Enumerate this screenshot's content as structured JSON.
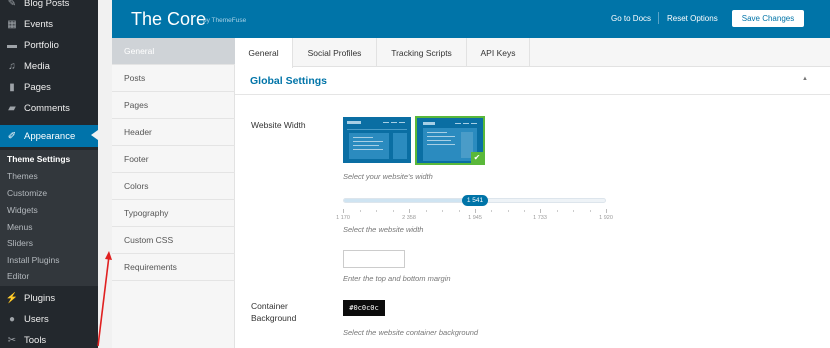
{
  "wp_menu": {
    "items": [
      {
        "label": "Blog Posts",
        "icon": "pin-icon"
      },
      {
        "label": "Events",
        "icon": "calendar-icon"
      },
      {
        "label": "Portfolio",
        "icon": "folder-icon"
      },
      {
        "label": "Media",
        "icon": "media-icon"
      },
      {
        "label": "Pages",
        "icon": "page-icon"
      },
      {
        "label": "Comments",
        "icon": "comment-icon"
      },
      {
        "label": "Appearance",
        "icon": "brush-icon"
      },
      {
        "label": "Plugins",
        "icon": "plug-icon"
      },
      {
        "label": "Users",
        "icon": "user-icon"
      },
      {
        "label": "Tools",
        "icon": "wrench-icon"
      }
    ],
    "submenu": [
      "Theme Settings",
      "Themes",
      "Customize",
      "Widgets",
      "Menus",
      "Sliders",
      "Install Plugins",
      "Editor"
    ],
    "accent_color": "#0073aa"
  },
  "header": {
    "title": "The Core",
    "byline": "by ThemeFuse",
    "docs_link": "Go to Docs",
    "reset_link": "Reset Options",
    "save_button": "Save Changes",
    "bg_color": "#0074a8"
  },
  "subnav": {
    "items": [
      "General",
      "Posts",
      "Pages",
      "Header",
      "Footer",
      "Colors",
      "Typography",
      "Custom CSS",
      "Requirements"
    ]
  },
  "tabs": [
    "General",
    "Social Profiles",
    "Tracking Scripts",
    "API Keys"
  ],
  "section": {
    "title": "Global Settings"
  },
  "website_width": {
    "label": "Website Width",
    "layout_desc": "Select your website's width",
    "slider_value": "1 541",
    "slider_desc": "Select the website width",
    "tick_labels": [
      "1 170",
      "2 358",
      "1 945",
      "1 733",
      "1 920"
    ]
  },
  "margin": {
    "desc": "Enter the top and bottom margin"
  },
  "container_bg": {
    "label": "Container Background",
    "value": "#0c0c0c",
    "desc": "Select the website container background"
  }
}
